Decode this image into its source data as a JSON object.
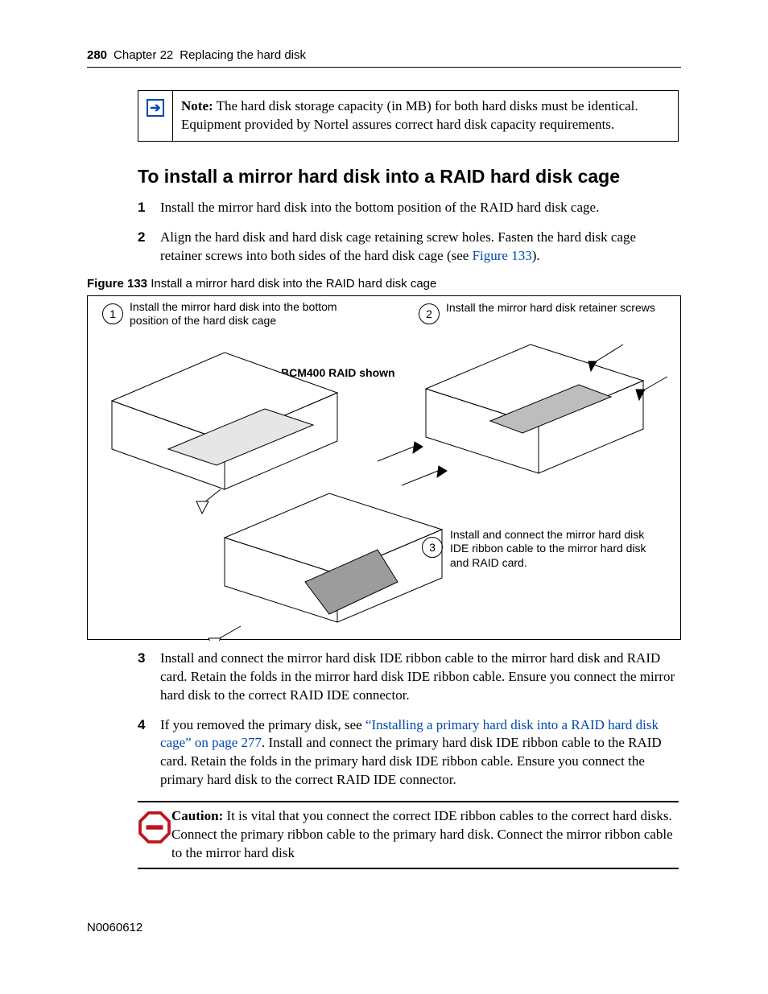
{
  "header": {
    "page_number": "280",
    "chapter": "Chapter 22",
    "chapter_title": "Replacing the hard disk"
  },
  "note": {
    "label": "Note:",
    "text": "The hard disk storage capacity (in MB) for both hard disks must be identical. Equipment provided by Nortel assures correct hard disk capacity requirements."
  },
  "section_title": "To install a mirror hard disk into a RAID hard disk cage",
  "steps_a": [
    {
      "n": "1",
      "text": "Install the mirror hard disk into the bottom position of the RAID hard disk cage."
    },
    {
      "n": "2",
      "text_before": "Align the hard disk and hard disk cage retaining screw holes. Fasten the hard disk cage retainer screws into both sides of the hard disk cage (see ",
      "link": "Figure 133",
      "text_after": ")."
    }
  ],
  "figure": {
    "label_bold": "Figure 133",
    "label_rest": "   Install a mirror hard disk into the RAID hard disk cage",
    "callouts": {
      "c1": {
        "n": "1",
        "text": "Install the mirror hard disk into the bottom position of the hard disk cage"
      },
      "c2": {
        "n": "2",
        "text": "Install the mirror hard disk retainer screws"
      },
      "c3": {
        "n": "3",
        "text": "Install and connect the mirror hard disk IDE ribbon cable to the mirror hard disk and RAID card."
      }
    },
    "raid_label": "BCM400 RAID shown"
  },
  "steps_b": [
    {
      "n": "3",
      "text": "Install and connect the mirror hard disk IDE ribbon cable to the mirror hard disk and RAID card. Retain the folds in the mirror hard disk IDE ribbon cable. Ensure you connect the mirror hard disk to the correct RAID IDE connector."
    },
    {
      "n": "4",
      "text_before": "If you removed the primary disk, see ",
      "link": "“Installing a primary hard disk into a RAID hard disk cage” on page 277",
      "text_after": ". Install and connect the primary hard disk IDE ribbon cable to the RAID card. Retain the folds in the primary hard disk IDE ribbon cable. Ensure you connect the primary hard disk to the correct RAID IDE connector."
    }
  ],
  "caution": {
    "label": "Caution:",
    "text": "It is vital that you connect the correct IDE ribbon cables to the correct hard disks. Connect the primary ribbon cable to the primary hard disk. Connect the mirror ribbon cable to the mirror hard disk"
  },
  "footer_id": "N0060612"
}
